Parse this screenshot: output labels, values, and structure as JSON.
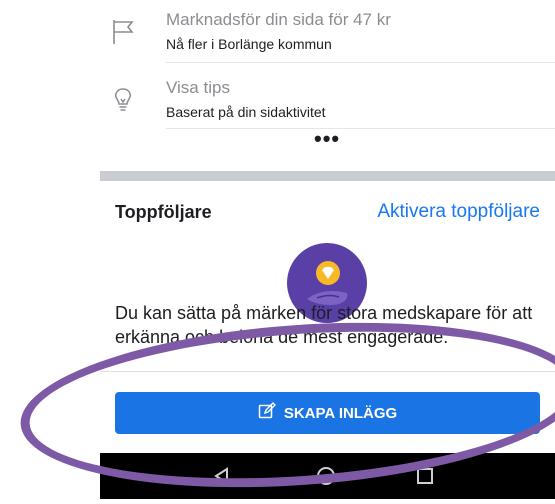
{
  "actions": [
    {
      "title": "Marknadsför din sida för 47 kr",
      "subtitle": "Nå fler i Borlänge kommun",
      "icon": "flag-icon"
    },
    {
      "title": "Visa tips",
      "subtitle": "Baserat på din sidaktivitet",
      "icon": "lightbulb-icon"
    }
  ],
  "more_label": "•••",
  "top_fans": {
    "title": "Toppföljare",
    "activate_link": "Aktivera toppföljare",
    "description": "Du kan sätta på märken för stora medskapare för att erkänna och belöna de mest engagerade.",
    "badge_icon": "diamond-badge-icon"
  },
  "create_post": {
    "label": "SKAPA INLÄGG",
    "icon": "edit-icon"
  },
  "navbar": {
    "back_icon": "back-icon",
    "home_icon": "home-icon",
    "recents_icon": "recents-icon"
  },
  "colors": {
    "accent": "#1b74e4",
    "annotation": "#7e5aa6",
    "badge_bg": "#5a3fa6",
    "badge_gem": "#f7b928"
  }
}
